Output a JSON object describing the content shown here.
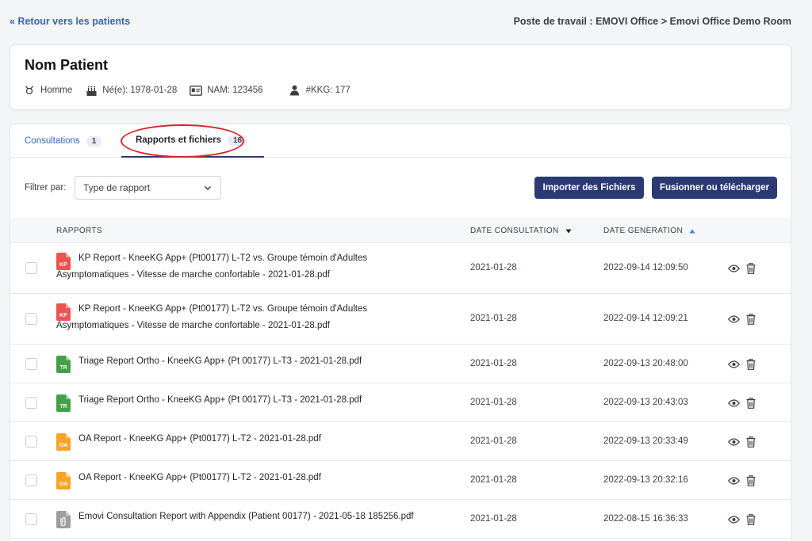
{
  "nav": {
    "back_label": "« Retour vers les patients",
    "workstation": "Poste de travail : EMOVI Office > Emovi Office Demo Room"
  },
  "patient": {
    "name": "Nom Patient",
    "sex": "Homme",
    "birth": "Né(e): 1978-01-28",
    "nam": "NAM: 123456",
    "kkg": "#KKG: 177"
  },
  "tabs": [
    {
      "label": "Consultations",
      "count": "1"
    },
    {
      "label": "Rapports et fichiers",
      "count": "16"
    }
  ],
  "filter": {
    "label": "Filtrer par:",
    "selected": "Type de rapport"
  },
  "buttons": {
    "import": "Importer des Fichiers",
    "merge": "Fusionner ou télécharger"
  },
  "table": {
    "headers": {
      "reports": "RAPPORTS",
      "consult_date": "DATE CONSULTATION",
      "gen_date": "DATE GENERATION"
    },
    "rows": [
      {
        "icon_type": "KP",
        "icon_color": "#ef5350",
        "name": "KP Report - KneeKG App+ (Pt00177) L-T2 vs. Groupe témoin d'Adultes Asymptomatiques - Vitesse de marche confortable - 2021-01-28.pdf",
        "consult": "2021-01-28",
        "generated": "2022-09-14 12:09:50"
      },
      {
        "icon_type": "KP",
        "icon_color": "#ef5350",
        "name": "KP Report - KneeKG App+ (Pt00177) L-T2 vs. Groupe témoin d'Adultes Asymptomatiques - Vitesse de marche confortable - 2021-01-28.pdf",
        "consult": "2021-01-28",
        "generated": "2022-09-14 12:09:21"
      },
      {
        "icon_type": "TR",
        "icon_color": "#43a047",
        "name": "Triage Report Ortho - KneeKG App+ (Pt 00177) L-T3 - 2021-01-28.pdf",
        "consult": "2021-01-28",
        "generated": "2022-09-13 20:48:00"
      },
      {
        "icon_type": "TR",
        "icon_color": "#43a047",
        "name": "Triage Report Ortho - KneeKG App+ (Pt 00177) L-T3 - 2021-01-28.pdf",
        "consult": "2021-01-28",
        "generated": "2022-09-13 20:43:03"
      },
      {
        "icon_type": "OA",
        "icon_color": "#f6a623",
        "name": "OA Report - KneeKG App+ (Pt00177) L-T2 - 2021-01-28.pdf",
        "consult": "2021-01-28",
        "generated": "2022-09-13 20:33:49"
      },
      {
        "icon_type": "OA",
        "icon_color": "#f6a623",
        "name": "OA Report - KneeKG App+ (Pt00177) L-T2 - 2021-01-28.pdf",
        "consult": "2021-01-28",
        "generated": "2022-09-13 20:32:16"
      },
      {
        "icon_type": "",
        "icon_color": "#9e9e9e",
        "name": "Emovi Consultation Report with Appendix (Patient 00177) - 2021-05-18 185256.pdf",
        "consult": "2021-01-28",
        "generated": "2022-08-15 16:36:33"
      }
    ]
  },
  "icons": {
    "sex": "gender-icon",
    "birth": "cake-icon",
    "nam": "id-card-icon",
    "kkg": "person-icon",
    "view": "eye-icon",
    "delete": "trash-icon"
  }
}
